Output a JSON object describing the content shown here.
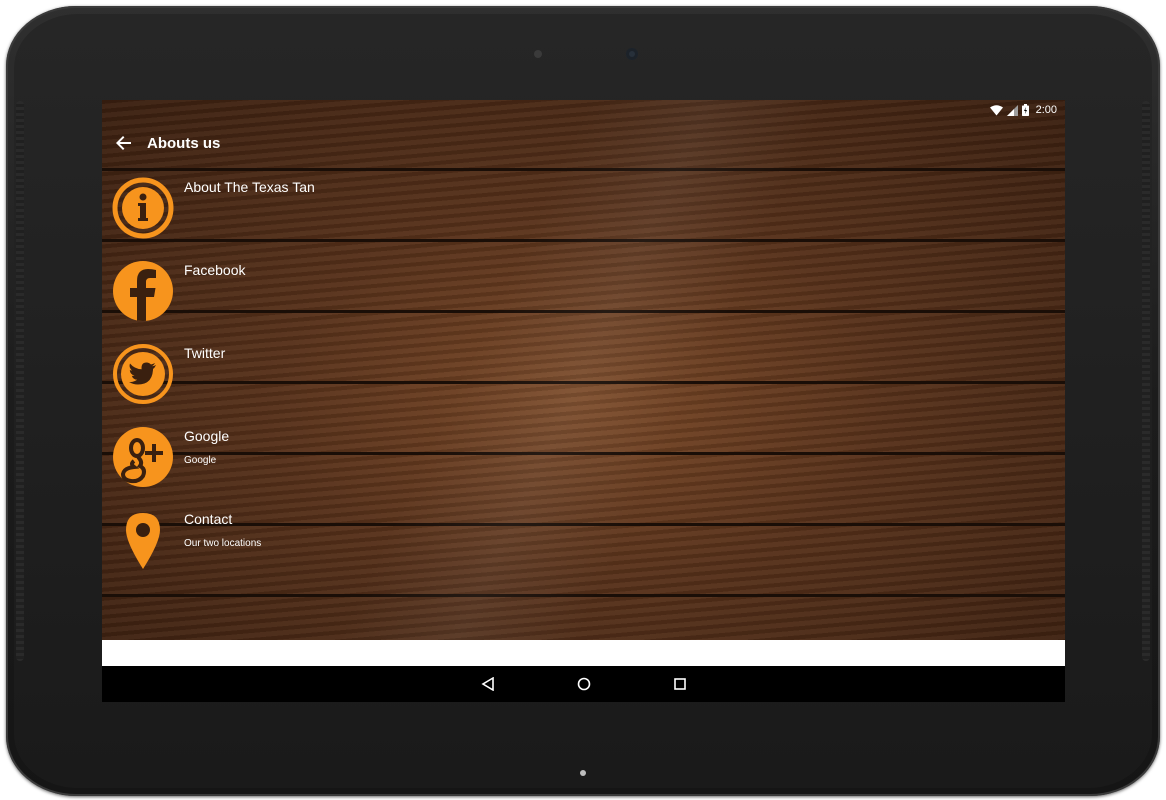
{
  "status_bar": {
    "time": "2:00"
  },
  "toolbar": {
    "title": "Abouts us"
  },
  "colors": {
    "accent": "#f7941d",
    "text": "#ffffff",
    "nav_bg": "#000000"
  },
  "items": [
    {
      "icon": "info-icon",
      "label": "About The Texas Tan",
      "subtitle": ""
    },
    {
      "icon": "facebook-icon",
      "label": "Facebook",
      "subtitle": ""
    },
    {
      "icon": "twitter-icon",
      "label": "Twitter",
      "subtitle": ""
    },
    {
      "icon": "google-plus-icon",
      "label": "Google",
      "subtitle": "Google"
    },
    {
      "icon": "location-pin-icon",
      "label": "Contact",
      "subtitle": "Our two locations"
    }
  ]
}
